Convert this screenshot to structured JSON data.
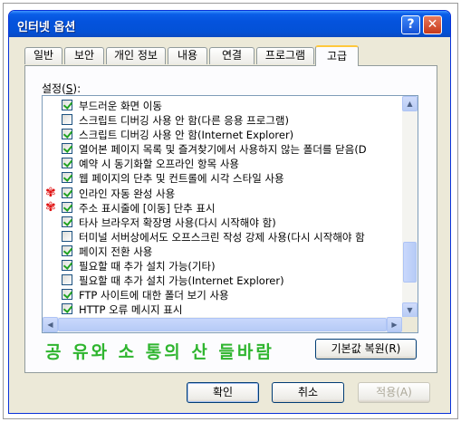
{
  "window": {
    "title": "인터넷 옵션",
    "help_label": "?",
    "close_label": "✕"
  },
  "tabs": [
    {
      "label": "일반"
    },
    {
      "label": "보안"
    },
    {
      "label": "개인 정보"
    },
    {
      "label": "내용"
    },
    {
      "label": "연결"
    },
    {
      "label": "프로그램"
    },
    {
      "label": "고급"
    }
  ],
  "settings": {
    "label_prefix": "설정(",
    "label_key": "S",
    "label_suffix": "):",
    "items": [
      {
        "label": "부드러운 화면 이동",
        "checked": true
      },
      {
        "label": "스크립트 디버깅 사용 안 함(다른 응용 프로그램)",
        "checked": false
      },
      {
        "label": "스크립트 디버깅 사용 안 함(Internet Explorer)",
        "checked": true
      },
      {
        "label": "열어본 페이지 목록 및 즐겨찾기에서 사용하지 않는 폴더를 닫음(D",
        "checked": true
      },
      {
        "label": "예약 시 동기화할 오프라인 항목 사용",
        "checked": true
      },
      {
        "label": "웹 페이지의 단추 및 컨트롤에 시각 스타일 사용",
        "checked": true
      },
      {
        "label": "인라인 자동 완성 사용",
        "checked": true,
        "marked": true
      },
      {
        "label": "주소 표시줄에 [이동] 단추 표시",
        "checked": true,
        "marked": true
      },
      {
        "label": "타사 브라우저 확장명 사용(다시 시작해야 함)",
        "checked": true
      },
      {
        "label": "터미널 서버상에서도 오프스크린 작성 강제 사용(다시 시작해야 함",
        "checked": false
      },
      {
        "label": "페이지 전환 사용",
        "checked": true
      },
      {
        "label": "필요할 때 추가 설치 가능(기타)",
        "checked": true
      },
      {
        "label": "필요할 때 추가 설치 가능(Internet Explorer)",
        "checked": false
      },
      {
        "label": "FTP 사이트에 대한 폴더 보기 사용",
        "checked": true
      },
      {
        "label": "HTTP 오류 메시지 표시",
        "checked": true
      }
    ],
    "scroll_up": "▲",
    "scroll_down": "▼",
    "scroll_left": "◀",
    "scroll_right": "▶",
    "marker_glyph": "✾"
  },
  "restore_button": "기본값 복원(R)",
  "slogan": "공 유와 소 통의 산 들바람",
  "buttons": {
    "ok": "확인",
    "cancel": "취소",
    "apply": "적용(A)"
  },
  "colors": {
    "title_bar": "#0453dd",
    "checkmark": "#21a121",
    "slogan": "#2fb52f",
    "marker": "#e01010"
  }
}
